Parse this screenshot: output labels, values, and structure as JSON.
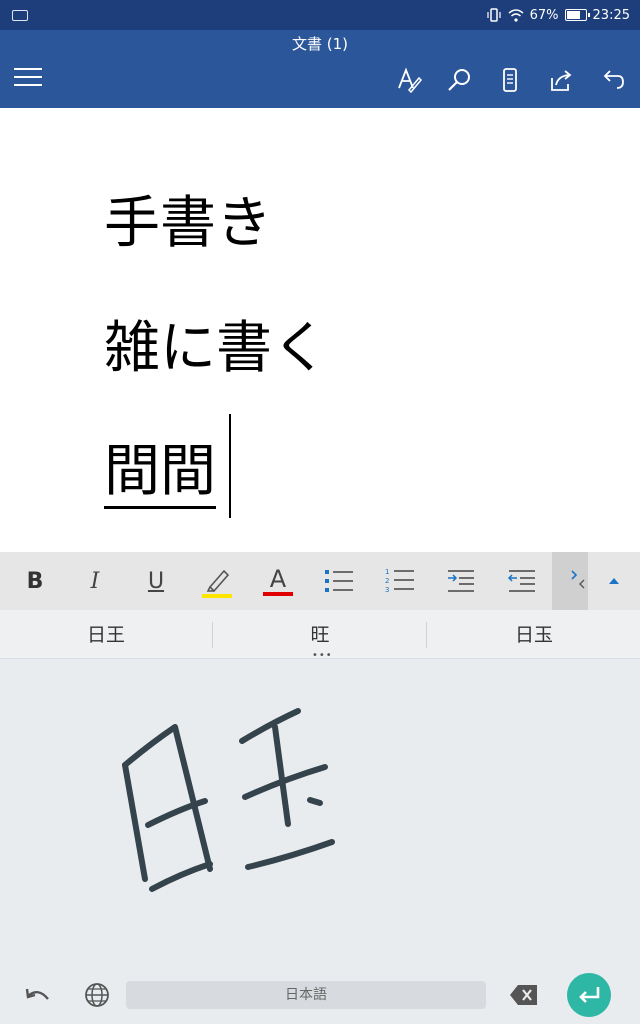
{
  "status": {
    "battery": "67%",
    "time": "23:25"
  },
  "appbar": {
    "title": "文書 (1)"
  },
  "document": {
    "lines": [
      "手書き",
      "雑に書く",
      "間間"
    ]
  },
  "format_toolbar": {
    "bold": "B",
    "italic": "I",
    "underline": "U",
    "font_color": "A"
  },
  "candidates": [
    "日王",
    "旺",
    "日玉"
  ],
  "keyboard": {
    "language": "日本語"
  },
  "colors": {
    "status_bar": "#1d3e7a",
    "app_bar": "#2b579a",
    "highlight": "#ffe600",
    "font_color": "#e00000",
    "accent": "#1b73c7",
    "enter": "#2fb7a5"
  }
}
